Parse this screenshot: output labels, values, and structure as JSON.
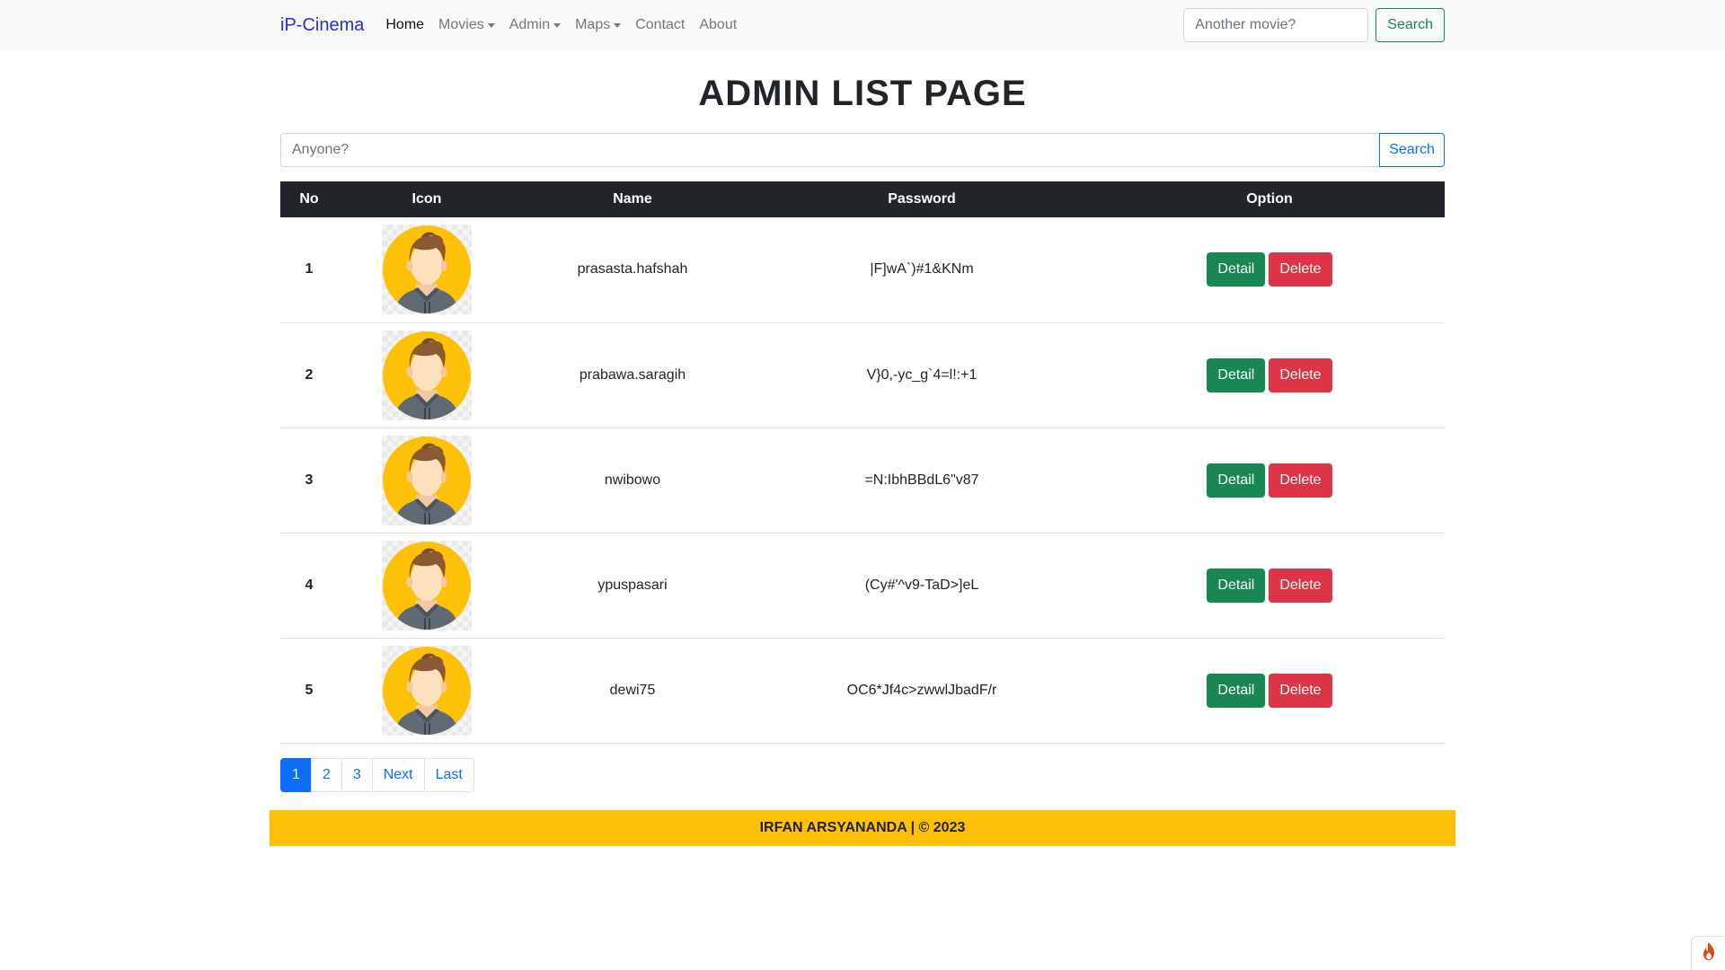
{
  "navbar": {
    "brand": "iP-Cinema",
    "links": [
      {
        "label": "Home",
        "active": true,
        "dropdown": false
      },
      {
        "label": "Movies",
        "active": false,
        "dropdown": true
      },
      {
        "label": "Admin",
        "active": false,
        "dropdown": true
      },
      {
        "label": "Maps",
        "active": false,
        "dropdown": true
      },
      {
        "label": "Contact",
        "active": false,
        "dropdown": false
      },
      {
        "label": "About",
        "active": false,
        "dropdown": false
      }
    ],
    "search": {
      "placeholder": "Another movie?",
      "button_label": "Search"
    }
  },
  "page": {
    "title": "ADMIN LIST PAGE",
    "search": {
      "placeholder": "Anyone?",
      "button_label": "Search"
    }
  },
  "table": {
    "headers": [
      "No",
      "Icon",
      "Name",
      "Password",
      "Option"
    ],
    "rows": [
      {
        "no": "1",
        "name": "prasasta.hafshah",
        "password": "|F]wA`)#1&KNm"
      },
      {
        "no": "2",
        "name": "prabawa.saragih",
        "password": "V}0,-yc_g`4=l!:+1"
      },
      {
        "no": "3",
        "name": "nwibowo",
        "password": "=N:IbhBBdL6\"v87"
      },
      {
        "no": "4",
        "name": "ypuspasari",
        "password": "(Cy#'^v9-TaD>]eL"
      },
      {
        "no": "5",
        "name": "dewi75",
        "password": "OC6*Jf4c>zwwlJbadF/r"
      }
    ],
    "detail_label": "Detail",
    "delete_label": "Delete"
  },
  "pagination": {
    "items": [
      {
        "label": "1",
        "active": true
      },
      {
        "label": "2",
        "active": false
      },
      {
        "label": "3",
        "active": false
      },
      {
        "label": "Next",
        "active": false
      },
      {
        "label": "Last",
        "active": false
      }
    ]
  },
  "footer": {
    "text": "IRFAN ARSYANANDA | © 2023"
  },
  "colors": {
    "brand": "#2b2bd6",
    "table_header": "#212529",
    "success": "#198754",
    "danger": "#dc3545",
    "primary": "#0d6efd",
    "footer": "#ffc107",
    "avatar_bg": "#ffc107"
  },
  "icons": {
    "avatar": "user-avatar-icon",
    "corner": "flame-icon"
  }
}
